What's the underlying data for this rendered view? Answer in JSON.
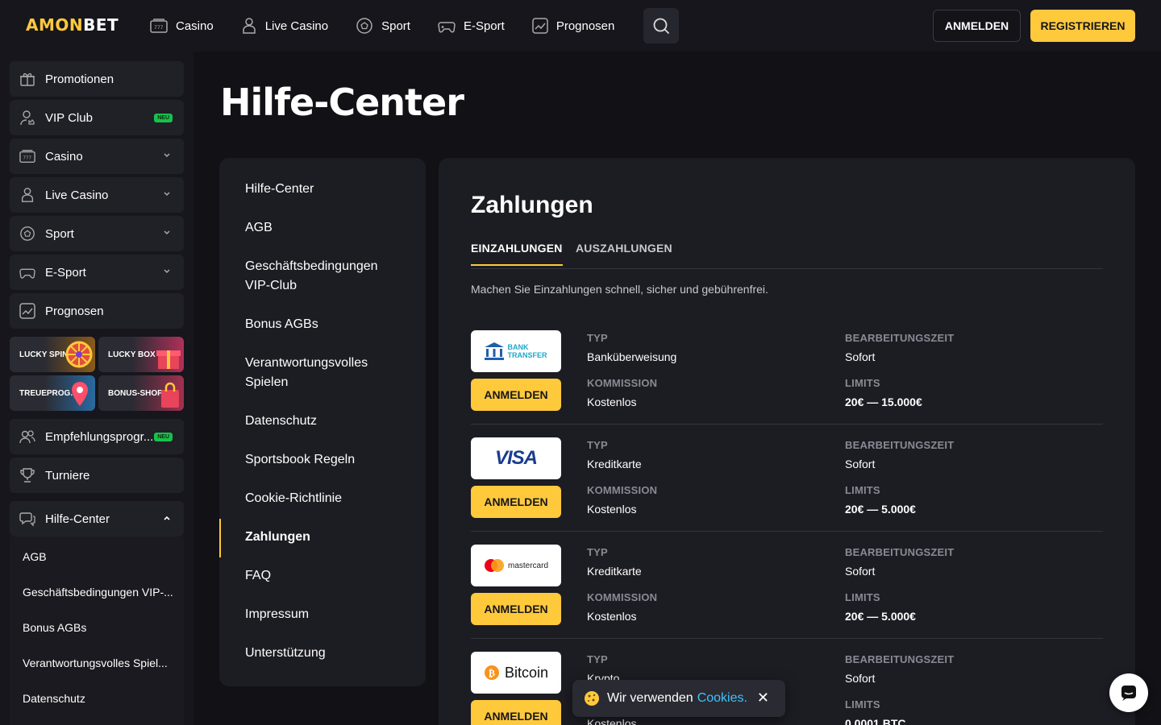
{
  "header": {
    "logo": {
      "part1": "AMON",
      "part2": "BET"
    },
    "nav": [
      {
        "label": "Casino",
        "icon": "slot-machine-icon"
      },
      {
        "label": "Live Casino",
        "icon": "dealer-icon"
      },
      {
        "label": "Sport",
        "icon": "soccer-ball-icon"
      },
      {
        "label": "E-Sport",
        "icon": "gamepad-icon"
      },
      {
        "label": "Prognosen",
        "icon": "chart-icon"
      }
    ],
    "login_label": "ANMELDEN",
    "register_label": "REGISTRIEREN"
  },
  "sidebar": {
    "items": [
      {
        "label": "Promotionen",
        "icon": "gift-icon"
      },
      {
        "label": "VIP Club",
        "icon": "user-crown-icon",
        "badge": "NEU"
      },
      {
        "label": "Casino",
        "icon": "slot-machine-icon"
      },
      {
        "label": "Live Casino",
        "icon": "dealer-icon"
      },
      {
        "label": "Sport",
        "icon": "soccer-ball-icon"
      },
      {
        "label": "E-Sport",
        "icon": "gamepad-icon"
      },
      {
        "label": "Prognosen",
        "icon": "chart-icon"
      }
    ],
    "promos": [
      {
        "label": "LUCKY SPIN"
      },
      {
        "label": "LUCKY BOX"
      },
      {
        "label": "TREUEPROG."
      },
      {
        "label": "BONUS-SHOP"
      }
    ],
    "referral": {
      "label": "Empfehlungsprogr...",
      "badge": "NEU"
    },
    "tournaments": {
      "label": "Turniere"
    },
    "help": {
      "label": "Hilfe-Center"
    },
    "help_sub": [
      "AGB",
      "Geschäftsbedingungen VIP-...",
      "Bonus AGBs",
      "Verantwortungsvolles Spiel...",
      "Datenschutz"
    ]
  },
  "main": {
    "title": "Hilfe-Center",
    "help_nav": [
      "Hilfe-Center",
      "AGB",
      "Geschäftsbedingungen VIP-Club",
      "Bonus AGBs",
      "Verantwortungsvolles Spielen",
      "Datenschutz",
      "Sportsbook Regeln",
      "Cookie-Richtlinie",
      "Zahlungen",
      "FAQ",
      "Impressum",
      "Unterstützung"
    ],
    "active_help": "Zahlungen",
    "section_title": "Zahlungen",
    "tabs": [
      "EINZAHLUNGEN",
      "AUSZAHLUNGEN"
    ],
    "intro": "Machen Sie Einzahlungen schnell, sicher und gebührenfrei.",
    "labels": {
      "type": "TYP",
      "commission": "KOMMISSION",
      "processing": "BEARBEITUNGSZEIT",
      "limits": "LIMITS",
      "button": "ANMELDEN"
    },
    "payments": [
      {
        "logo_text": "BANK TRANSFER",
        "type": "Banküberweisung",
        "commission": "Kostenlos",
        "processing": "Sofort",
        "limits": "20€ — 15.000€"
      },
      {
        "logo_text": "VISA",
        "type": "Kreditkarte",
        "commission": "Kostenlos",
        "processing": "Sofort",
        "limits": "20€ — 5.000€"
      },
      {
        "logo_text": "mastercard",
        "type": "Kreditkarte",
        "commission": "Kostenlos",
        "processing": "Sofort",
        "limits": "20€ — 5.000€"
      },
      {
        "logo_text": "Bitcoin",
        "type": "Krypto",
        "commission": "Kostenlos",
        "processing": "Sofort",
        "limits": "0.0001 BTC"
      }
    ]
  },
  "cookie": {
    "text": "Wir verwenden",
    "link": "Cookies."
  },
  "colors": {
    "accent": "#ffc93c",
    "background": "#111116",
    "panel": "#1c1c23",
    "badge": "#17c24a",
    "link": "#3ec3ff"
  }
}
